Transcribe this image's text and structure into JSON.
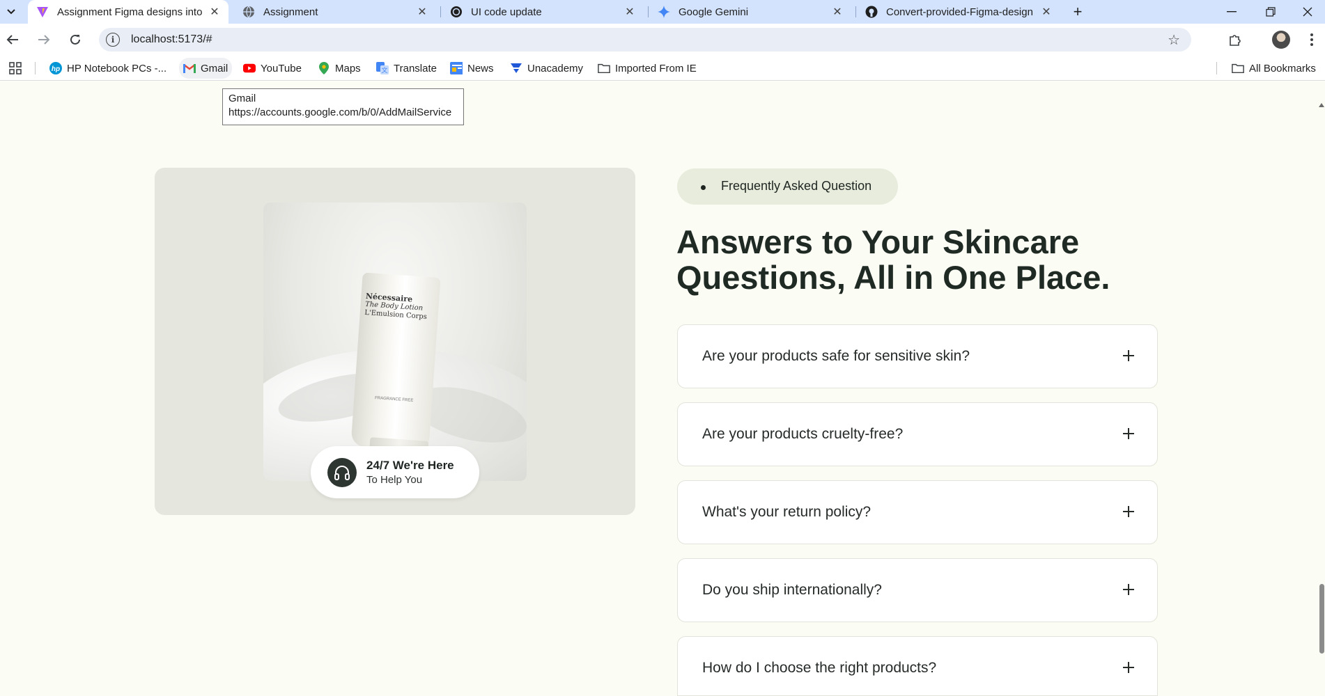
{
  "browser": {
    "tabs": [
      {
        "title": "Assignment Figma designs into",
        "icon": "vite-icon",
        "active": true
      },
      {
        "title": "Assignment",
        "icon": "globe-icon",
        "active": false
      },
      {
        "title": "UI code update",
        "icon": "openai-icon",
        "active": false
      },
      {
        "title": "Google Gemini",
        "icon": "gemini-icon",
        "active": false
      },
      {
        "title": "Convert-provided-Figma-design",
        "icon": "github-icon",
        "active": false
      }
    ],
    "url": "localhost:5173/#",
    "bookmarks": [
      {
        "label": "HP Notebook PCs -...",
        "icon": "hp-icon"
      },
      {
        "label": "Gmail",
        "icon": "gmail-icon"
      },
      {
        "label": "YouTube",
        "icon": "youtube-icon"
      },
      {
        "label": "Maps",
        "icon": "maps-icon"
      },
      {
        "label": "Translate",
        "icon": "translate-icon"
      },
      {
        "label": "News",
        "icon": "news-icon"
      },
      {
        "label": "Unacademy",
        "icon": "unacademy-icon"
      },
      {
        "label": "Imported From IE",
        "icon": "folder-icon"
      }
    ],
    "all_bookmarks": "All Bookmarks",
    "tooltip": {
      "title": "Gmail",
      "url": "https://accounts.google.com/b/0/AddMailService"
    }
  },
  "faq_section": {
    "badge": "Frequently Asked Question",
    "heading": "Answers to Your Skincare Questions, All in One Place.",
    "support": {
      "title": "24/7 We're Here",
      "subtitle": "To Help You"
    },
    "product": {
      "brand": "Nécessaire",
      "line1": "The Body Lotion",
      "line2": "L'Emulsion Corps",
      "small": "FRAGRANCE FREE"
    },
    "questions": [
      "Are your products safe for sensitive skin?",
      "Are your products cruelty-free?",
      "What's your return policy?",
      "Do you ship internationally?",
      "How do I choose the right products?"
    ]
  },
  "colors": {
    "page_bg": "#fbfcf3",
    "heading": "#1f2a25",
    "badge_bg": "#e7ecdc",
    "image_card_bg": "#e5e6de"
  }
}
